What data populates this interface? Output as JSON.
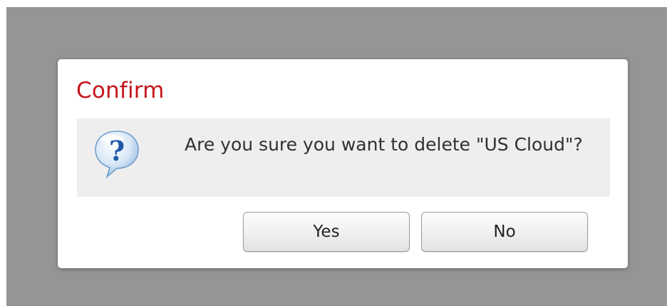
{
  "dialog": {
    "title": "Confirm",
    "message": "Are you sure you want to delete \"US Cloud\"?",
    "icon": "question-bubble-icon",
    "buttons": {
      "yes_label": "Yes",
      "no_label": "No"
    }
  },
  "colors": {
    "title": "#c4161c",
    "backdrop": "#959595",
    "panel": "#eeeeee",
    "icon_blue": "#2f6fb7"
  }
}
